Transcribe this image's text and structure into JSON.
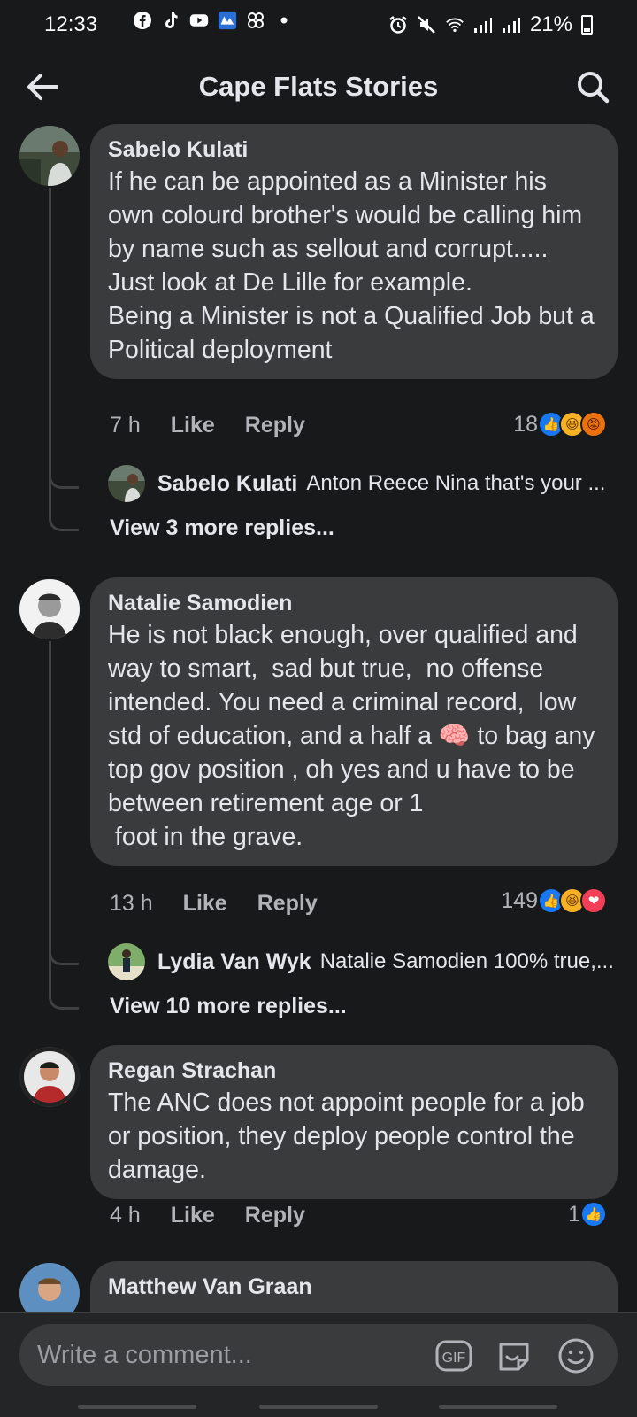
{
  "status_bar": {
    "time": "12:33",
    "battery": "21%",
    "left_icons": [
      "facebook-icon",
      "tiktok-icon",
      "youtube-icon",
      "news-app-icon",
      "pinwheel-icon",
      "dot-icon"
    ],
    "right_icons": [
      "alarm-icon",
      "mute-icon",
      "wifi-icon",
      "signal-icon",
      "signal-icon",
      "battery-icon"
    ]
  },
  "header": {
    "title": "Cape Flats Stories"
  },
  "comments": [
    {
      "author": "Sabelo Kulati",
      "text": "If he can be appointed as a Minister his own colourd brother's would be calling him by name such as sellout and corrupt.....\nJust look at De Lille for example.\nBeing a Minister is not a Qualified Job but a Political deployment",
      "time": "7 h",
      "like_label": "Like",
      "reply_label": "Reply",
      "reaction_count": "18",
      "reactions": [
        "like",
        "haha",
        "angry"
      ],
      "reply_preview": {
        "author": "Sabelo Kulati",
        "text": "Anton Reece Nina that's your ..."
      },
      "more_replies": "View 3 more replies..."
    },
    {
      "author": "Natalie Samodien",
      "text": "He is not black enough, over qualified and way to smart,  sad but true,  no offense intended. You need a criminal record,  low std of education, and a half a 🧠 to bag any top gov position , oh yes and u have to be  between retirement age or 1\n foot in the grave.",
      "time": "13 h",
      "like_label": "Like",
      "reply_label": "Reply",
      "reaction_count": "149",
      "reactions": [
        "like",
        "haha",
        "love"
      ],
      "reply_preview": {
        "author": "Lydia Van Wyk",
        "text": "Natalie Samodien 100% true,..."
      },
      "more_replies": "View 10 more replies..."
    },
    {
      "author": "Regan Strachan",
      "text": "The ANC does not appoint people for a job or position, they deploy people control the damage.",
      "time": "4 h",
      "like_label": "Like",
      "reply_label": "Reply",
      "reaction_count": "1",
      "reactions": [
        "like"
      ]
    },
    {
      "author": "Matthew Van Graan"
    }
  ],
  "composer": {
    "placeholder": "Write a comment...",
    "gif_label": "GIF"
  }
}
